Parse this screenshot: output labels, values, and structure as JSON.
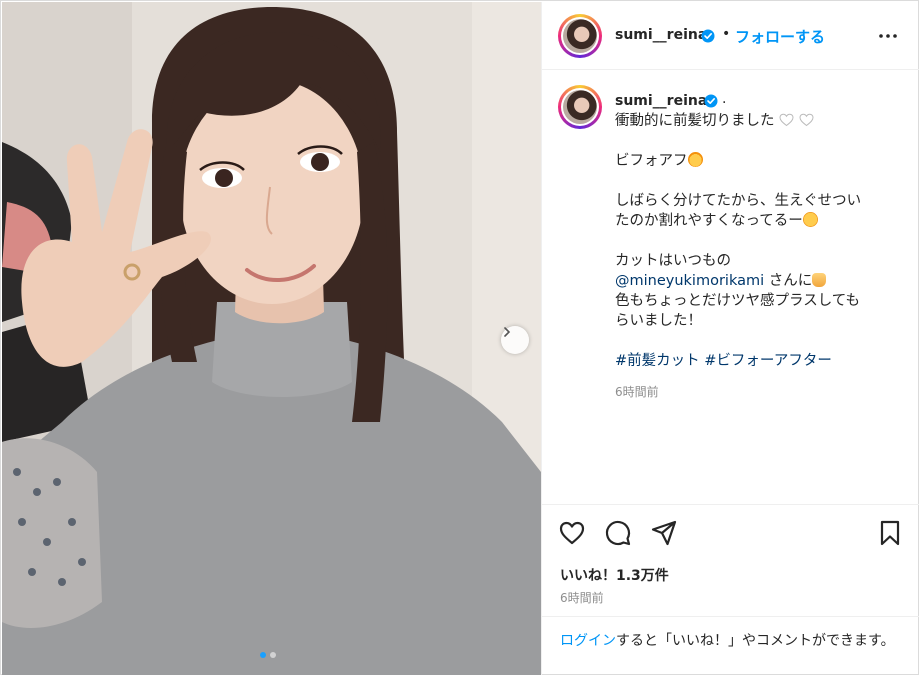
{
  "account": {
    "username": "sumi__reina",
    "follow_label": "フォローする",
    "separator": "•"
  },
  "caption": {
    "username": "sumi__reina",
    "trailing": ".",
    "line1": "衝動的に前髪切りました",
    "line2": "ビフォアフ",
    "line3a": "しばらく分けてたから、生えぐせつい",
    "line3b": "たのか割れやすくなってるー",
    "line4": "カットはいつもの",
    "mention": "@mineyukimorikami",
    "line5_after_mention": " さんに",
    "line6a": "色もちょっとだけツヤ感プラスしても",
    "line6b": "らいました！",
    "tag1": "#前髪カット",
    "tag2": "#ビフォーアフター",
    "timestamp": "6時間前"
  },
  "engagement": {
    "likes_label": "いいね！",
    "likes_count": "1.3万件",
    "timestamp": "6時間前"
  },
  "login_prompt": {
    "link": "ログイン",
    "text": "すると「いいね！」やコメントができます。"
  },
  "carousel": {
    "slide_count": 2,
    "active_index": 0
  },
  "icons": {
    "verified": "verified-badge-icon",
    "more": "more-options-icon",
    "like": "heart-icon",
    "comment": "comment-icon",
    "share": "share-icon",
    "save": "bookmark-icon",
    "next": "chevron-right-icon"
  },
  "colors": {
    "link_blue": "#0095f6",
    "hashtag": "#00376b",
    "muted": "#8e8e8e",
    "text": "#262626"
  }
}
